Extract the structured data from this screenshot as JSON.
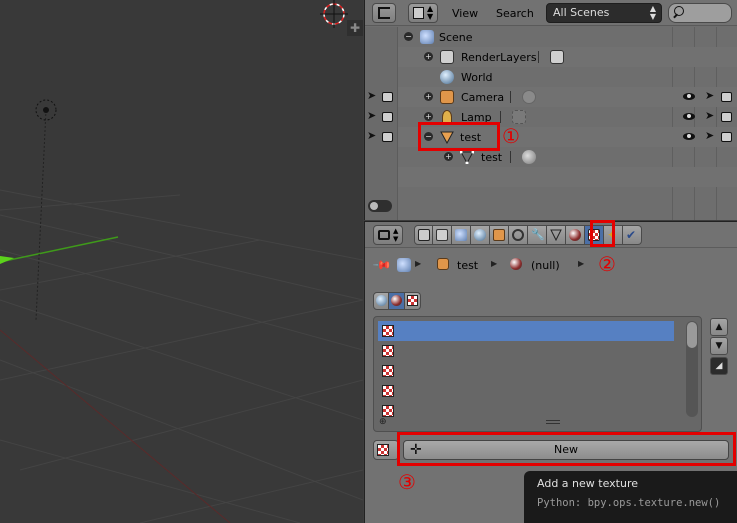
{
  "outliner": {
    "view_menu": "View",
    "search_menu": "Search",
    "display_mode": "All Scenes",
    "rows": [
      {
        "label": "Scene"
      },
      {
        "label": "RenderLayers"
      },
      {
        "label": "World"
      },
      {
        "label": "Camera"
      },
      {
        "label": "Lamp"
      },
      {
        "label": "test"
      },
      {
        "label": "test"
      }
    ]
  },
  "properties": {
    "breadcrumb": {
      "object": "test",
      "material": "(null)"
    },
    "texture_slots": {
      "count": 5,
      "selected_index": 0
    },
    "new_button": {
      "label": "New"
    }
  },
  "tooltip": {
    "title": "Add a new texture",
    "python": "Python: bpy.ops.texture.new()"
  },
  "annotations": {
    "marker_1": "①",
    "marker_2": "②",
    "marker_3": "③",
    "color": "#e30000"
  },
  "icons": [
    "editor-type-icon",
    "scene-icon",
    "render-layers-icon",
    "world-icon",
    "camera-icon",
    "lamp-icon",
    "mesh-icon",
    "material-icon",
    "texture-icon",
    "pin-icon",
    "plus-icon",
    "cursor-icon",
    "eye-icon",
    "render-icon"
  ]
}
